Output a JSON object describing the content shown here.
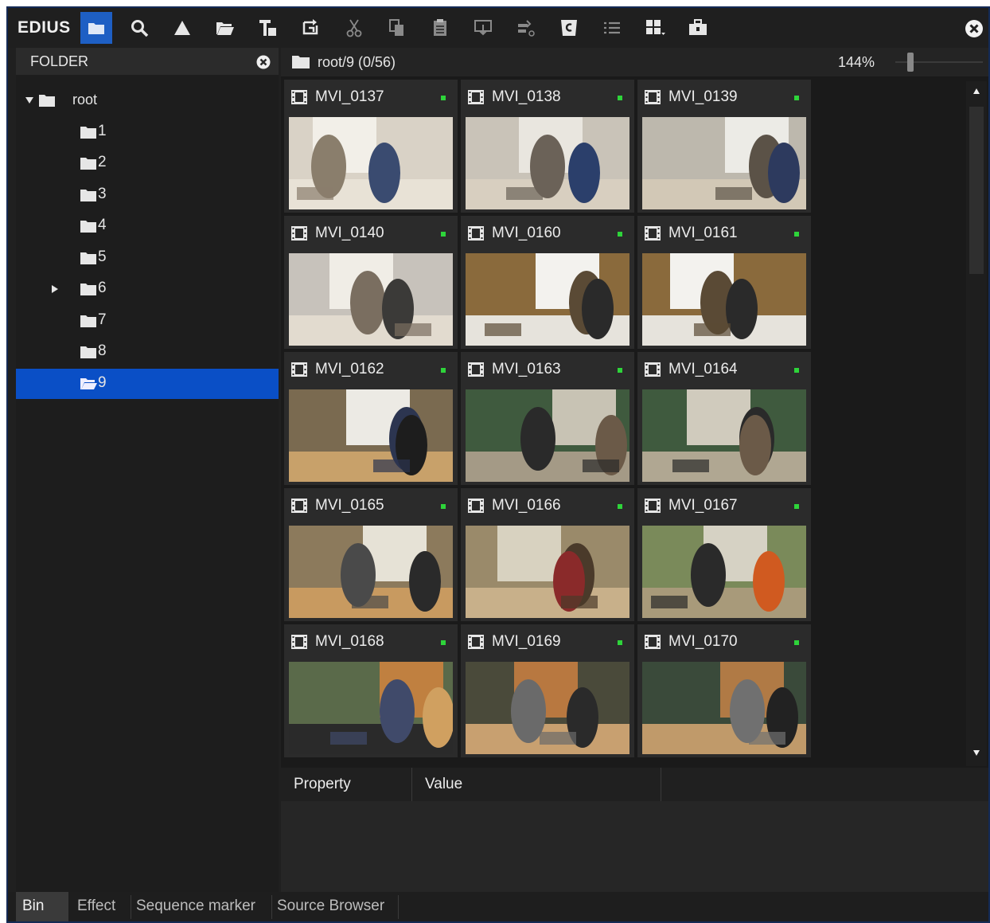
{
  "app": {
    "logo": "EDIUS"
  },
  "toolbar": {
    "buttons": [
      {
        "icon": "folder-view-icon",
        "active": true
      },
      {
        "icon": "search-icon"
      },
      {
        "icon": "up-arrow-icon"
      },
      {
        "icon": "open-folder-icon"
      },
      {
        "icon": "new-title-icon"
      },
      {
        "icon": "replace-clip-icon"
      },
      {
        "icon": "cut-icon"
      },
      {
        "icon": "copy-icon"
      },
      {
        "icon": "paste-icon"
      },
      {
        "icon": "add-to-player-icon"
      },
      {
        "icon": "add-to-timeline-icon"
      },
      {
        "icon": "sync-icon"
      },
      {
        "icon": "list-view-icon"
      },
      {
        "icon": "thumbnail-view-icon"
      },
      {
        "icon": "toolbox-icon"
      }
    ]
  },
  "folder_panel": {
    "title": "FOLDER",
    "tree": [
      {
        "label": "root",
        "expanded": true
      },
      {
        "label": "1"
      },
      {
        "label": "2"
      },
      {
        "label": "3"
      },
      {
        "label": "4"
      },
      {
        "label": "5"
      },
      {
        "label": "6",
        "collapsed": true
      },
      {
        "label": "7"
      },
      {
        "label": "8"
      },
      {
        "label": "9",
        "selected": true
      }
    ]
  },
  "content": {
    "path": "root/9 (0/56)",
    "zoom": "144%",
    "clips": [
      {
        "name": "MVI_0137"
      },
      {
        "name": "MVI_0138"
      },
      {
        "name": "MVI_0139"
      },
      {
        "name": "MVI_0140"
      },
      {
        "name": "MVI_0160"
      },
      {
        "name": "MVI_0161"
      },
      {
        "name": "MVI_0162"
      },
      {
        "name": "MVI_0163"
      },
      {
        "name": "MVI_0164"
      },
      {
        "name": "MVI_0165"
      },
      {
        "name": "MVI_0166"
      },
      {
        "name": "MVI_0167"
      },
      {
        "name": "MVI_0168"
      },
      {
        "name": "MVI_0169"
      },
      {
        "name": "MVI_0170"
      }
    ]
  },
  "properties": {
    "col_property": "Property",
    "col_value": "Value"
  },
  "tabs": [
    "Bin",
    "Effect",
    "Sequence marker",
    "Source Browser"
  ],
  "colors": {
    "accent": "#0a4fc6",
    "status_dot": "#2ed43a"
  }
}
